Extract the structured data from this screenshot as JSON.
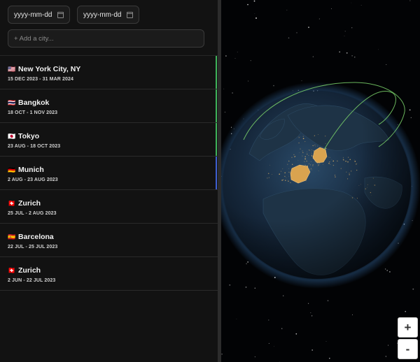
{
  "filters": {
    "start_date_placeholder": "yyyy-mm-dd",
    "end_date_placeholder": "yyyy-mm-dd",
    "add_city_placeholder": "+ Add a city..."
  },
  "trips": [
    {
      "flag": "🇺🇸",
      "city": "New York City, NY",
      "dates": "15 DEC 2023 - 31 MAR 2024",
      "accent": "#3fb35a"
    },
    {
      "flag": "🇹🇭",
      "city": "Bangkok",
      "dates": "18 OCT - 1 NOV 2023",
      "accent": "#3fb35a"
    },
    {
      "flag": "🇯🇵",
      "city": "Tokyo",
      "dates": "23 AUG - 18 OCT 2023",
      "accent": "#3fb35a"
    },
    {
      "flag": "🇩🇪",
      "city": "Munich",
      "dates": "2 AUG - 23 AUG 2023",
      "accent": "#3f5fd0"
    },
    {
      "flag": "🇨🇭",
      "city": "Zurich",
      "dates": "25 JUL - 2 AUG 2023",
      "accent": ""
    },
    {
      "flag": "🇪🇸",
      "city": "Barcelona",
      "dates": "22 JUL - 25 JUL 2023",
      "accent": ""
    },
    {
      "flag": "🇨🇭",
      "city": "Zurich",
      "dates": "2 JUN - 22 JUL 2023",
      "accent": ""
    }
  ],
  "map": {
    "zoom_in_label": "+",
    "zoom_out_label": "-",
    "route_color": "#7bd36b",
    "highlight_color": "#e8b15a"
  }
}
